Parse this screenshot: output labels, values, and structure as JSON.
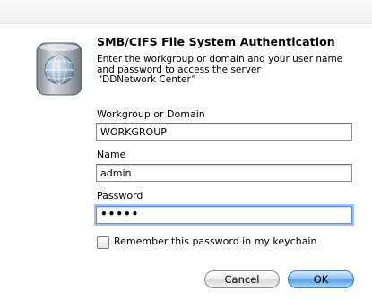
{
  "dialog": {
    "title": "SMB/CIFS File System Authentication",
    "message_lines": [
      "Enter the workgroup or domain and your user name",
      "and password to access the server",
      "“DDNetwork Center”"
    ]
  },
  "fields": {
    "workgroup": {
      "label": "Workgroup or Domain",
      "value": "WORKGROUP"
    },
    "name": {
      "label": "Name",
      "value": "admin"
    },
    "password": {
      "label": "Password",
      "value": "•••••"
    }
  },
  "remember": {
    "label": "Remember this password in my keychain",
    "checked": false
  },
  "buttons": {
    "cancel": "Cancel",
    "ok": "OK"
  },
  "icon": "network-server-globe-icon",
  "colors": {
    "focus_ring": "#9dc1f2",
    "default_button": "#5aa1e6"
  }
}
